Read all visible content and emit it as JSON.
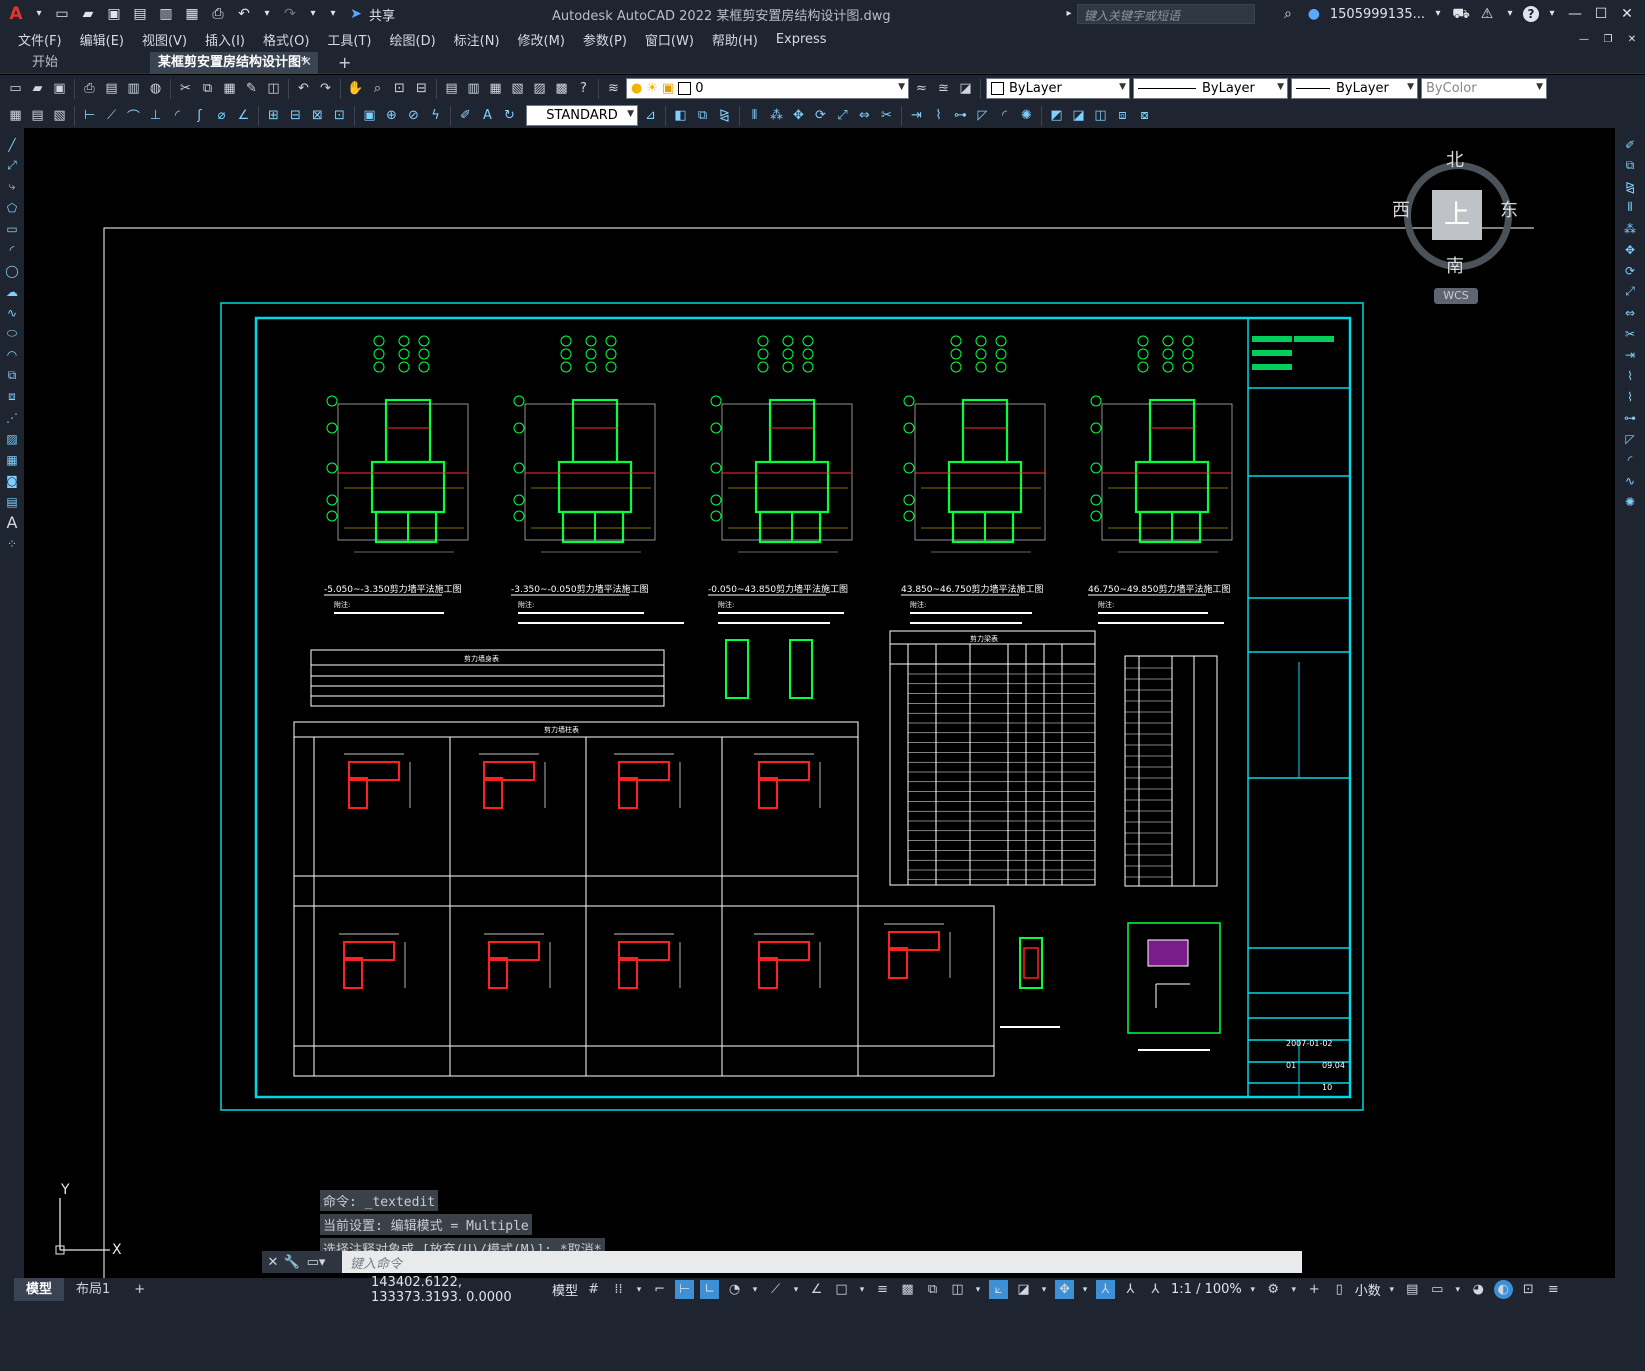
{
  "app": {
    "title": "Autodesk AutoCAD 2022    某框剪安置房结构设计图.dwg",
    "share_label": "共享",
    "search_placeholder": "键入关键字或短语",
    "user_name": "1505999135...",
    "help": "?"
  },
  "menu": {
    "items": [
      "文件(F)",
      "编辑(E)",
      "视图(V)",
      "插入(I)",
      "格式(O)",
      "工具(T)",
      "绘图(D)",
      "标注(N)",
      "修改(M)",
      "参数(P)",
      "窗口(W)",
      "帮助(H)",
      "Express"
    ]
  },
  "tabs": {
    "start": "开始",
    "drawing": "某框剪安置房结构设计图*",
    "close": "✕",
    "add": "+"
  },
  "toolbar": {
    "layer_name": "0",
    "color": "ByLayer",
    "linetype": "ByLayer",
    "lineweight": "ByLayer",
    "plotstyle": "ByColor",
    "textstyle": "STANDARD"
  },
  "viewcube": {
    "top": "上",
    "north": "北",
    "south": "南",
    "west": "西",
    "east": "东",
    "wcs": "WCS"
  },
  "drawing": {
    "plan_titles": [
      "-5.050~-3.350剪力墙平法施工图",
      "-3.350~-0.050剪力墙平法施工图",
      "-0.050~43.850剪力墙平法施工图",
      "43.850~46.750剪力墙平法施工图",
      "46.750~49.850剪力墙平法施工图"
    ],
    "note_heading": "附注:",
    "table_titles": {
      "wall_body": "剪力墙身表",
      "wall_column": "剪力墙柱表",
      "beam_table": "剪力梁表"
    },
    "titleblock": {
      "date": "2007-01-02",
      "code": "09.04",
      "sheet": "10",
      "edition": "01"
    }
  },
  "command": {
    "history": [
      "命令: _textedit",
      "当前设置: 编辑模式 = Multiple",
      "选择注释对象或 [放弃(U)/模式(M)]: *取消*"
    ],
    "input_placeholder": "键入命令"
  },
  "layout_tabs": [
    "模型",
    "布局1",
    "+"
  ],
  "status": {
    "coords": "143402.6122, 133373.3193, 0.0000",
    "model_label": "模型",
    "scale": "1:1 / 100%",
    "units": "小数"
  },
  "ucs": {
    "x": "X",
    "y": "Y"
  }
}
